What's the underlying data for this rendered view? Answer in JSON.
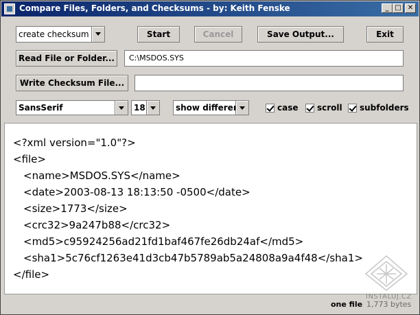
{
  "window": {
    "title": "Compare Files, Folders, and Checksums - by: Keith Fenske",
    "minimize": "_",
    "maximize": "□",
    "close": "✕"
  },
  "toolbar": {
    "mode_value": "create checksum",
    "start_label": "Start",
    "cancel_label": "Cancel",
    "save_label": "Save Output...",
    "exit_label": "Exit"
  },
  "read": {
    "button_label": "Read File or Folder...",
    "value": "C:\\MSDOS.SYS"
  },
  "write": {
    "button_label": "Write Checksum File...",
    "value": ""
  },
  "options": {
    "font_value": "SansSerif",
    "size_value": "18",
    "show_value": "show different",
    "case_label": "case",
    "scroll_label": "scroll",
    "subfolders_label": "subfolders"
  },
  "output": {
    "lines": [
      "<?xml version=\"1.0\"?>",
      "<file>",
      "<name>MSDOS.SYS</name>",
      "<date>2003-08-13 18:13:50 -0500</date>",
      "<size>1773</size>",
      "<crc32>9a247b88</crc32>",
      "<md5>c95924256ad21fd1baf467fe26db24af</md5>",
      "<sha1>5c76cf1263e41d3cb47b5789ab5a24808a9a4f48</sha1>",
      "</file>"
    ]
  },
  "status": {
    "count": "one file",
    "size": "1,773 bytes"
  },
  "watermark": {
    "text": "INSTALUJ.CZ"
  }
}
